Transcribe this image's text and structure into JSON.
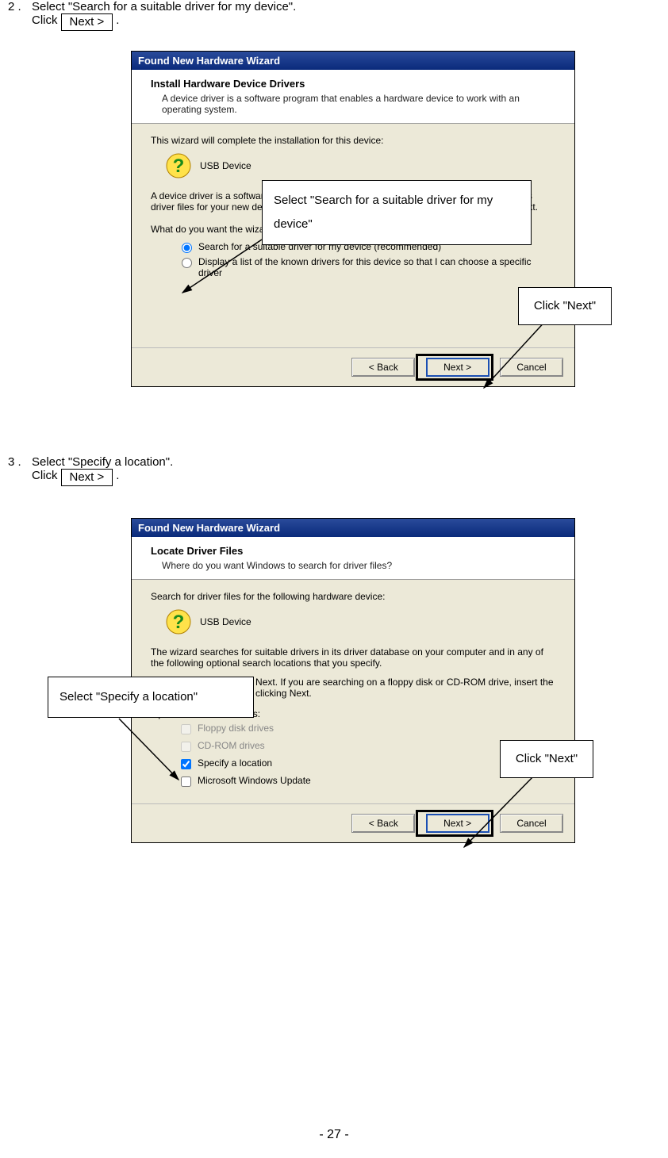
{
  "step2": {
    "num": "2 .",
    "line1": "Select \"Search for a suitable driver for my device\".",
    "click_word": "Click",
    "button_label": "Next >",
    "period": "."
  },
  "step3": {
    "num": "3 .",
    "line1": "Select \"Specify a location\".",
    "click_word": "Click",
    "button_label": "Next >",
    "period": "."
  },
  "dialog1": {
    "title": "Found New Hardware Wizard",
    "header_bold": "Install Hardware Device Drivers",
    "header_sub": "A device driver is a software program that enables a hardware device to work with an operating system.",
    "prompt1": "This wizard will complete the installation for this device:",
    "device": "USB Device",
    "desc": "A device driver is a software program that makes a hardware device work. Windows needs driver files for your new device. To locate driver files and complete the installation click Next.",
    "question": "What do you want the wizard to do?",
    "radio1": "Search for a suitable driver for my device (recommended)",
    "radio2": "Display a list of the known drivers for this device so that I can choose a specific driver",
    "btn_back": "< Back",
    "btn_next": "Next >",
    "btn_cancel": "Cancel"
  },
  "dialog2": {
    "title": "Found New Hardware Wizard",
    "header_bold": "Locate Driver Files",
    "header_sub": "Where do you want Windows to search for driver files?",
    "prompt1": "Search for driver files for the following hardware device:",
    "device": "USB Device",
    "desc1": "The wizard searches for suitable drivers in its driver database on your computer and in any of the following optional search locations that you specify.",
    "desc2": "To start the search, click Next. If you are searching on a floppy disk or CD-ROM drive, insert the floppy disk or CD before clicking Next.",
    "opt_label": "Optional search locations:",
    "chk1": "Floppy disk drives",
    "chk2": "CD-ROM drives",
    "chk3": "Specify a location",
    "chk4": "Microsoft Windows Update",
    "btn_back": "< Back",
    "btn_next": "Next >",
    "btn_cancel": "Cancel"
  },
  "callouts": {
    "c1": "Select \"Search for a suitable driver for my device\"",
    "c2": "Click \"Next\"",
    "c3": "Select \"Specify a location\"",
    "c4": "Click \"Next\""
  },
  "page_num": "- 27 -"
}
